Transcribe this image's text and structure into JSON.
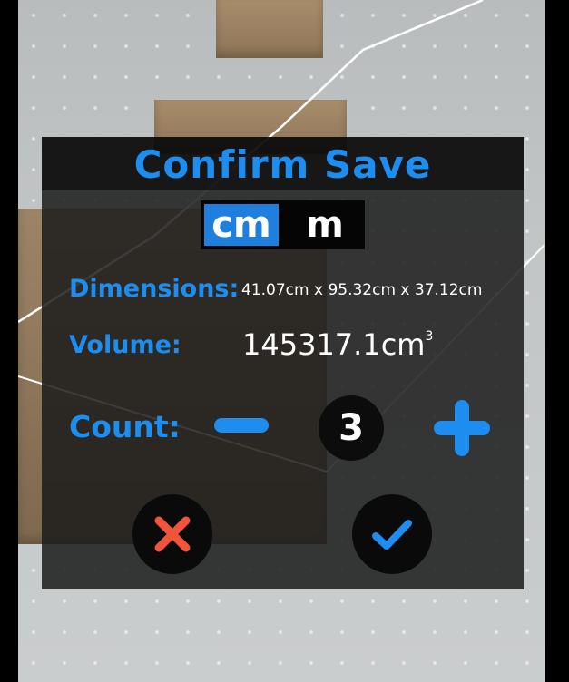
{
  "dialog": {
    "title": "Confirm Save",
    "units": {
      "options": [
        "cm",
        "m"
      ],
      "selected": "cm"
    },
    "dimensions": {
      "label": "Dimensions:",
      "value": "41.07cm x 95.32cm x 37.12cm"
    },
    "volume": {
      "label": "Volume:",
      "value": "145317.1cm",
      "superscript": "3"
    },
    "count": {
      "label": "Count:",
      "value": "3"
    },
    "actions": {
      "cancel_icon": "close-icon",
      "confirm_icon": "check-icon"
    }
  },
  "colors": {
    "accent": "#1d8ef0",
    "cancel": "#f2543b",
    "dialog_bg": "#1c1c1c"
  }
}
